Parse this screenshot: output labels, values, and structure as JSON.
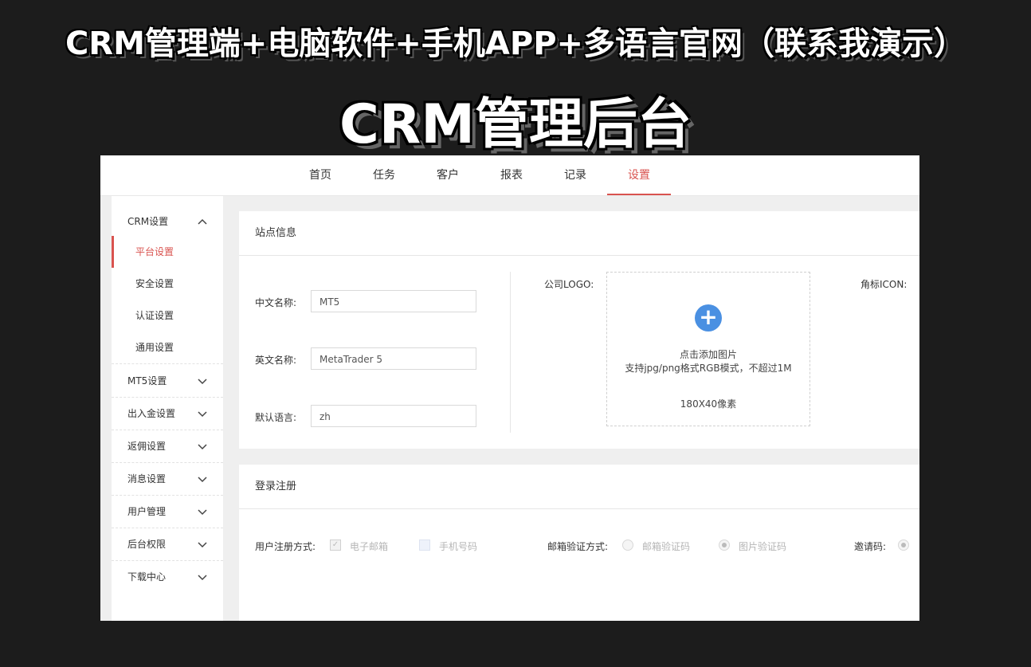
{
  "banner": {
    "line1": "CRM管理端+电脑软件+手机APP+多语言官网（联系我演示）",
    "line2": "CRM管理后台"
  },
  "nav": {
    "items": [
      "首页",
      "任务",
      "客户",
      "报表",
      "记录",
      "设置"
    ],
    "active": "设置"
  },
  "sidebar": {
    "groups": [
      {
        "label": "CRM设置",
        "expanded": true,
        "children": [
          "平台设置",
          "安全设置",
          "认证设置",
          "通用设置"
        ],
        "active_child": "平台设置"
      },
      {
        "label": "MT5设置"
      },
      {
        "label": "出入金设置"
      },
      {
        "label": "返佣设置"
      },
      {
        "label": "消息设置"
      },
      {
        "label": "用户管理"
      },
      {
        "label": "后台权限"
      },
      {
        "label": "下载中心"
      }
    ]
  },
  "site_info": {
    "title": "站点信息",
    "cn_name_label": "中文名称:",
    "cn_name_value": "MT5",
    "en_name_label": "英文名称:",
    "en_name_value": "MetaTrader 5",
    "lang_label": "默认语言:",
    "lang_value": "zh",
    "logo_label": "公司LOGO:",
    "upload_hint1": "点击添加图片",
    "upload_hint2": "支持jpg/png格式RGB模式，不超过1M",
    "upload_size": "180X40像素",
    "icon_label": "角标ICON:"
  },
  "login_register": {
    "title": "登录注册",
    "reg_method_label": "用户注册方式:",
    "opt_email": "电子邮箱",
    "opt_phone": "手机号码",
    "email_verify_label": "邮箱验证方式:",
    "opt_email_code": "邮箱验证码",
    "opt_image_code": "图片验证码",
    "invite_label": "邀请码:"
  },
  "colors": {
    "accent": "#d9534f",
    "upload_button": "#4a90e2"
  }
}
